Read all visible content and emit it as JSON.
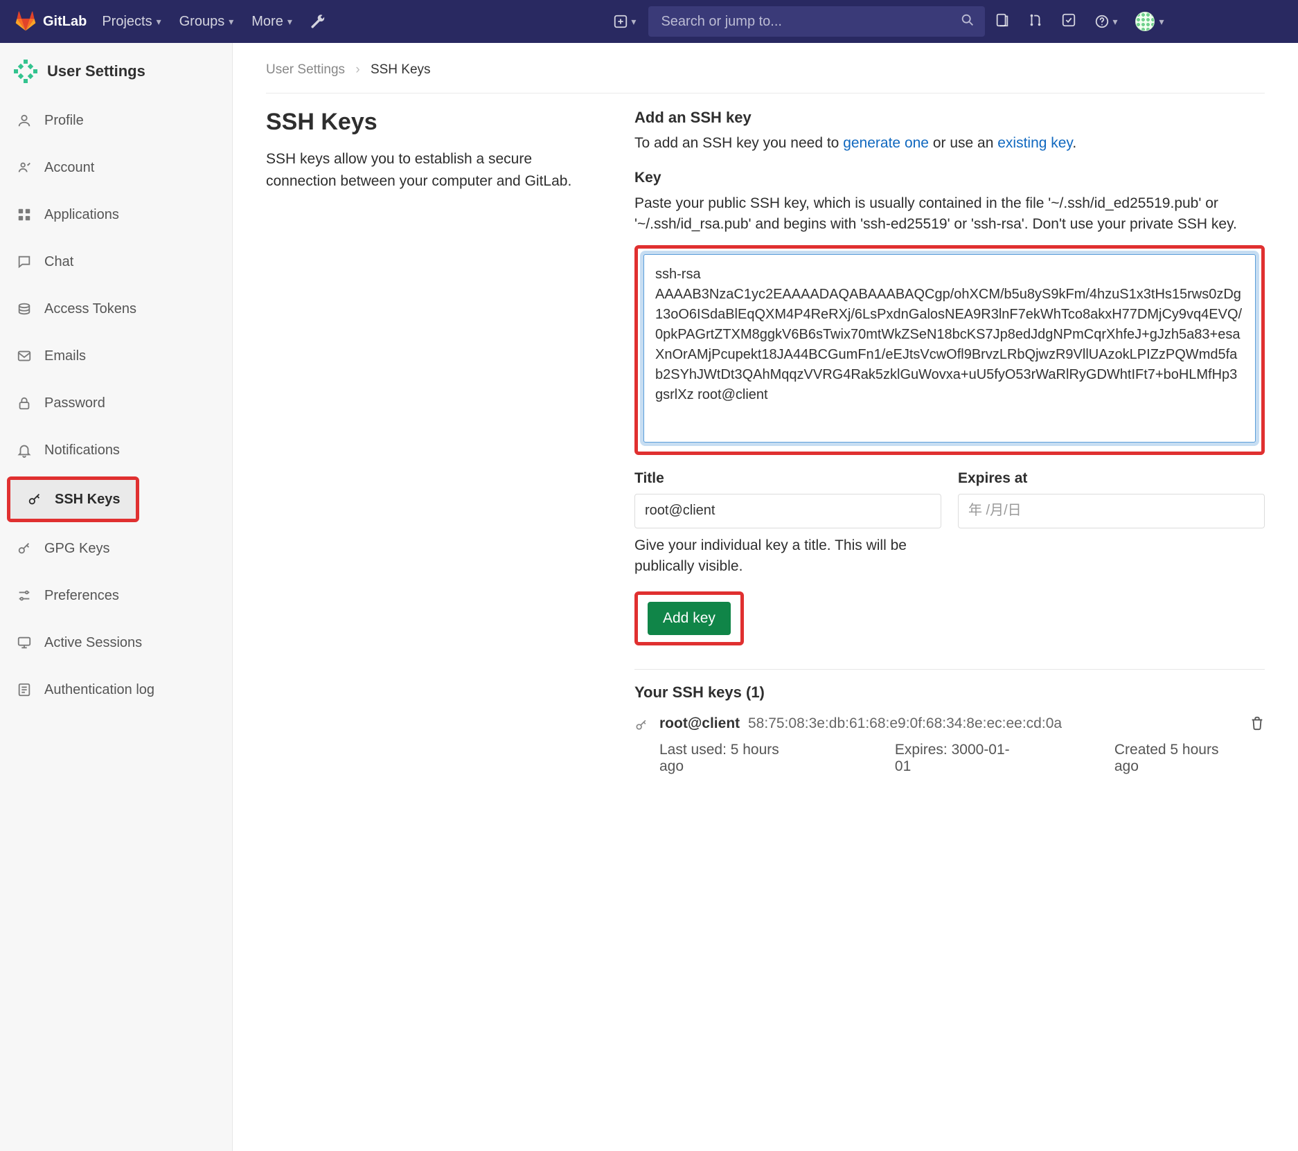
{
  "nav": {
    "brand": "GitLab",
    "menu": [
      "Projects",
      "Groups",
      "More"
    ],
    "search_placeholder": "Search or jump to..."
  },
  "sidebar": {
    "title": "User Settings",
    "items": [
      "Profile",
      "Account",
      "Applications",
      "Chat",
      "Access Tokens",
      "Emails",
      "Password",
      "Notifications",
      "SSH Keys",
      "GPG Keys",
      "Preferences",
      "Active Sessions",
      "Authentication log"
    ],
    "active_index": 8
  },
  "breadcrumb": {
    "parent": "User Settings",
    "current": "SSH Keys"
  },
  "intro": {
    "heading": "SSH Keys",
    "body": "SSH keys allow you to establish a secure connection between your computer and GitLab."
  },
  "add": {
    "heading": "Add an SSH key",
    "lead_before": "To add an SSH key you need to ",
    "lead_link1": "generate one",
    "lead_mid": " or use an ",
    "lead_link2": "existing key",
    "lead_after": ".",
    "key_label": "Key",
    "key_hint": "Paste your public SSH key, which is usually contained in the file '~/.ssh/id_ed25519.pub' or '~/.ssh/id_rsa.pub' and begins with 'ssh-ed25519' or 'ssh-rsa'. Don't use your private SSH key.",
    "key_value": "ssh-rsa AAAAB3NzaC1yc2EAAAADAQABAAABAQCgp/ohXCM/b5u8yS9kFm/4hzuS1x3tHs15rws0zDg13oO6ISdaBlEqQXM4P4ReRXj/6LsPxdnGalosNEA9R3lnF7ekWhTco8akxH77DMjCy9vq4EVQ/0pkPAGrtZTXM8ggkV6B6sTwix70mtWkZSeN18bcKS7Jp8edJdgNPmCqrXhfeJ+gJzh5a83+esaXnOrAMjPcupekt18JA44BCGumFn1/eEJtsVcwOfl9BrvzLRbQjwzR9VllUAzokLPIZzPQWmd5fab2SYhJWtDt3QAhMqqzVVRG4Rak5zklGuWovxa+uU5fyO53rWaRlRyGDWhtIFt7+boHLMfHp3gsrlXz root@client",
    "title_label": "Title",
    "title_value": "root@client",
    "expires_label": "Expires at",
    "expires_placeholder": "年 /月/日",
    "title_hint": "Give your individual key a title. This will be publically visible.",
    "button": "Add key"
  },
  "list": {
    "heading": "Your SSH keys (1)",
    "entry": {
      "name": "root@client",
      "fingerprint": "58:75:08:3e:db:61:68:e9:0f:68:34:8e:ec:ee:cd:0a",
      "last_used": "Last used: 5 hours ago",
      "expires": "Expires: 3000-01-01",
      "created": "Created 5 hours ago"
    }
  }
}
